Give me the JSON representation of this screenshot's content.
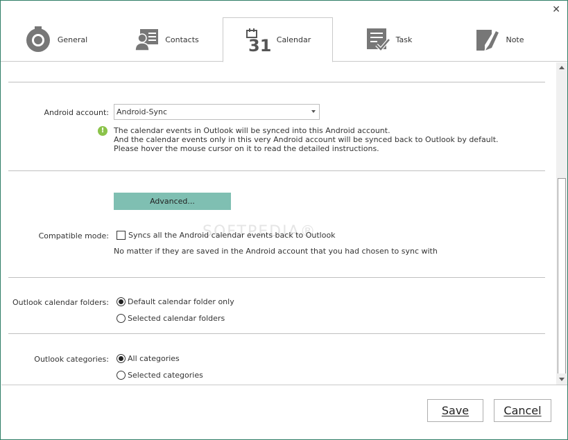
{
  "window": {
    "close_glyph": "✕"
  },
  "tabs": [
    {
      "label": "General",
      "icon": "gear-icon"
    },
    {
      "label": "Contacts",
      "icon": "contacts-card-icon"
    },
    {
      "label": "Calendar",
      "icon": "calendar-icon",
      "icon_text": "31",
      "active": true
    },
    {
      "label": "Task",
      "icon": "task-checklist-icon"
    },
    {
      "label": "Note",
      "icon": "note-pencil-icon"
    }
  ],
  "android_account": {
    "label": "Android account:",
    "selected": "Android-Sync",
    "info_glyph": "!",
    "info_lines": [
      "The calendar events in Outlook will be synced into this Android account.",
      "And the calendar events only in this very Android account will be synced back to Outlook by default.",
      "Please hover the mouse cursor on it to read the detailed instructions."
    ]
  },
  "advanced": {
    "button_label": "Advanced..."
  },
  "compatible_mode": {
    "label": "Compatible mode:",
    "checkbox_label": "Syncs all the Android calendar events back to Outlook",
    "checked": false,
    "note": "No matter if they are saved in the Android account that you had chosen to sync with"
  },
  "calendar_folders": {
    "label": "Outlook calendar folders:",
    "options": [
      "Default calendar folder only",
      "Selected calendar folders"
    ],
    "selected_index": 0
  },
  "categories": {
    "label": "Outlook categories:",
    "options": [
      "All categories",
      "Selected categories"
    ],
    "selected_index": 0
  },
  "watermark": "SOFTPEDIA®",
  "buttons": {
    "save": "Save",
    "cancel": "Cancel"
  },
  "colors": {
    "accent": "#7fbfb2",
    "border": "#2e7d66",
    "info": "#8bc34a"
  }
}
